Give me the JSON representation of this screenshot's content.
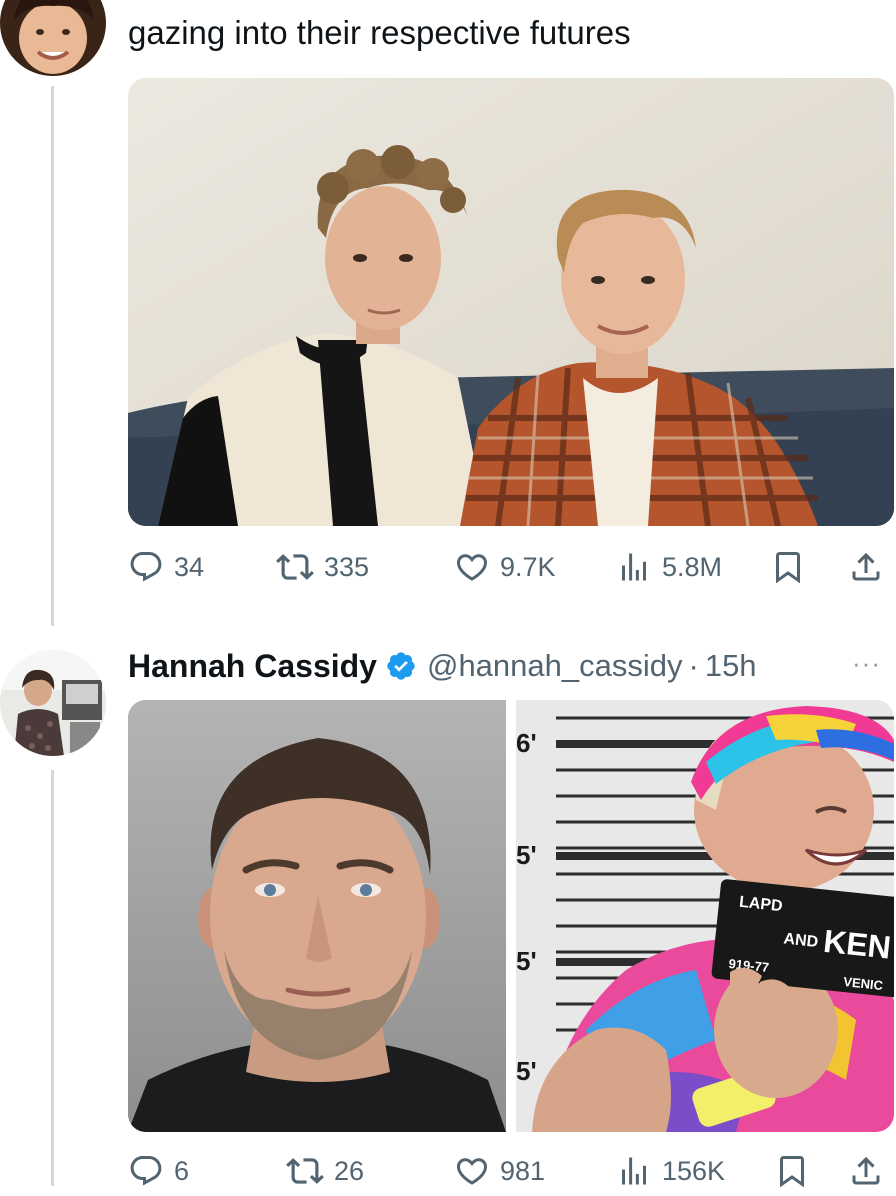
{
  "thread": {
    "tweet1": {
      "text": "gazing into their respective futures",
      "metrics": {
        "replies": "34",
        "retweets": "335",
        "likes": "9.7K",
        "views": "5.8M"
      }
    },
    "tweet2": {
      "display_name": "Hannah Cassidy",
      "handle": "@hannah_cassidy",
      "separator": "·",
      "time": "15h",
      "more": "···",
      "metrics": {
        "replies": "6",
        "retweets": "26",
        "likes": "981",
        "views": "156K"
      },
      "mugshot_sign": {
        "line1": "LAPD",
        "line2_small": "AND",
        "line2_big": "KEN",
        "line3_left": "919-77",
        "line3_right": "VENIC"
      },
      "height_marks": [
        "6'",
        "5'",
        "5'",
        "5'"
      ]
    }
  },
  "icons": {
    "reply": "reply-icon",
    "retweet": "retweet-icon",
    "like": "heart-icon",
    "views": "views-icon",
    "bookmark": "bookmark-icon",
    "share": "share-icon",
    "verified": "verified-badge-icon"
  },
  "colors": {
    "text": "#0f1419",
    "secondary": "#536471",
    "verified": "#1d9bf0",
    "thread_line": "#cfd9de"
  }
}
